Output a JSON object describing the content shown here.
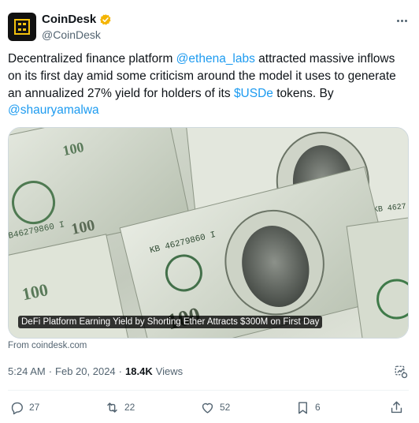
{
  "author": {
    "display_name": "CoinDesk",
    "handle": "@CoinDesk",
    "verified": true,
    "verified_color": "#f4b400"
  },
  "tweet": {
    "text_1": "Decentralized finance platform ",
    "mention_1": "@ethena_labs",
    "text_2": " attracted massive inflows on its first day amid some criticism around the model it uses to generate an annualized 27% yield for holders of its ",
    "cashtag": "$USDe",
    "text_3": " tokens. By ",
    "mention_2": "@shauryamalwa",
    "link_color": "#1d9bf0"
  },
  "card": {
    "caption": "DeFi Platform Earning Yield by Shorting Ether Attracts $300M on First Day",
    "source": "From coindesk.com"
  },
  "meta": {
    "time": "5:24 AM",
    "date": "Feb 20, 2024",
    "views_count": "18.4K",
    "views_label": "Views",
    "separator": "·"
  },
  "actions": {
    "replies": "27",
    "reposts": "22",
    "likes": "52",
    "bookmarks": "6"
  },
  "icons": [
    "more-icon",
    "verified-badge-icon",
    "grok-icon",
    "reply-icon",
    "repost-icon",
    "like-icon",
    "bookmark-icon",
    "share-icon"
  ]
}
